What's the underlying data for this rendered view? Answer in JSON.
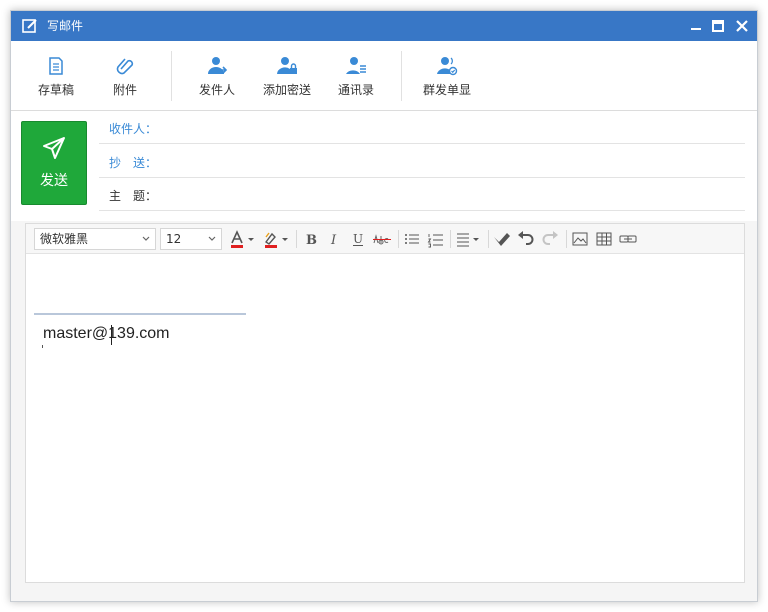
{
  "window": {
    "title": "写邮件"
  },
  "toolbar": {
    "save_draft": "存草稿",
    "attachment": "附件",
    "sender": "发件人",
    "add_bcc": "添加密送",
    "contacts": "通讯录",
    "mass_send": "群发单显"
  },
  "compose": {
    "send_label": "发送",
    "to_label": "收件人：",
    "cc_label": "抄　送：",
    "subject_label": "主　题："
  },
  "editor": {
    "font_family": "微软雅黑",
    "font_size": "12",
    "signature_text": "master@139.com"
  },
  "colors": {
    "titlebar": "#3877c6",
    "send_button": "#1fa83a",
    "accent_blue": "#3a8ad6",
    "font_color_bar": "#e02020"
  }
}
